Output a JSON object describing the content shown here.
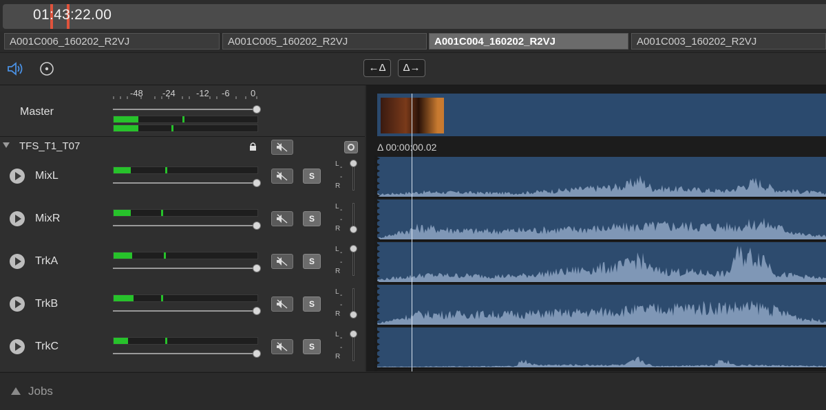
{
  "timecode": "01:43:22.00",
  "clips": [
    {
      "label": "A001C006_160202_R2VJ",
      "active": false
    },
    {
      "label": "A001C005_160202_R2VJ",
      "active": false
    },
    {
      "label": "A001C004_160202_R2VJ",
      "active": true
    },
    {
      "label": "A001C003_160202_R2VJ",
      "active": false
    }
  ],
  "toolbar": {
    "speaker_icon": "speaker-icon",
    "record_icon": "circle-target-icon",
    "prev_delta_label": "←Δ",
    "next_delta_label": "Δ→"
  },
  "meter_scale": [
    "-48",
    "-24",
    "-12",
    "-6",
    "0"
  ],
  "master": {
    "label": "Master",
    "levels": [
      0.17,
      0.17
    ],
    "peaks": [
      0.48,
      0.4
    ]
  },
  "group": {
    "label": "TFS_T1_T07",
    "lock_icon": "lock-icon",
    "mute_icon": "speaker-muted-icon",
    "settings_icon": "gear-icon"
  },
  "tracks": [
    {
      "name": "MixL",
      "level": 0.12,
      "peak": 0.36,
      "solo": "S",
      "pan_l": "L",
      "pan_r": "R",
      "pan": 0.0
    },
    {
      "name": "MixR",
      "level": 0.12,
      "peak": 0.33,
      "solo": "S",
      "pan_l": "L",
      "pan_r": "R",
      "pan": 1.0
    },
    {
      "name": "TrkA",
      "level": 0.13,
      "peak": 0.35,
      "solo": "S",
      "pan_l": "L",
      "pan_r": "R",
      "pan": 0.0
    },
    {
      "name": "TrkB",
      "level": 0.14,
      "peak": 0.33,
      "solo": "S",
      "pan_l": "L",
      "pan_r": "R",
      "pan": 1.0
    },
    {
      "name": "TrkC",
      "level": 0.1,
      "peak": 0.36,
      "solo": "S",
      "pan_l": "L",
      "pan_r": "R",
      "pan": 0.0
    }
  ],
  "delta_readout": "Δ 00:00:00.02",
  "jobs_label": "Jobs",
  "colors": {
    "accent": "#4a90e2",
    "meter": "#27c22b",
    "lane": "#2d4b6e",
    "playhead_marker": "#e0533c"
  }
}
